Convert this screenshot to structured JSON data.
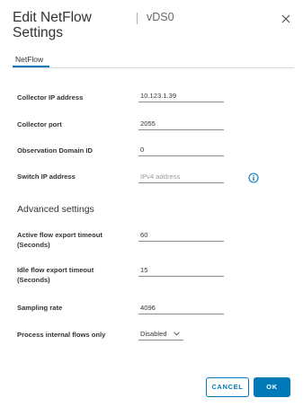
{
  "dialog": {
    "title": "Edit NetFlow Settings",
    "subtitle": "vDS0"
  },
  "tabs": [
    {
      "label": "NetFlow",
      "active": true
    }
  ],
  "fields": {
    "collector_ip": {
      "label": "Collector IP address",
      "value": "10.123.1.39",
      "placeholder": ""
    },
    "collector_port": {
      "label": "Collector port",
      "value": "2055",
      "placeholder": ""
    },
    "observation_domain_id": {
      "label": "Observation Domain ID",
      "value": "0",
      "placeholder": ""
    },
    "switch_ip": {
      "label": "Switch IP address",
      "value": "",
      "placeholder": "IPv4 address"
    }
  },
  "advanced": {
    "title": "Advanced settings",
    "active_timeout": {
      "label_line1": "Active flow export timeout",
      "label_line2": "(Seconds)",
      "value": "60"
    },
    "idle_timeout": {
      "label_line1": "Idle flow export timeout",
      "label_line2": "(Seconds)",
      "value": "15"
    },
    "sampling_rate": {
      "label": "Sampling rate",
      "value": "4096"
    },
    "internal_flows": {
      "label": "Process internal flows only",
      "value": "Disabled"
    }
  },
  "buttons": {
    "cancel": "CANCEL",
    "ok": "OK"
  },
  "colors": {
    "accent": "#0079b8",
    "text": "#333333",
    "info_icon": "#0079b8"
  },
  "icons": {
    "close": "close-icon",
    "info": "info-icon",
    "dropdown": "chevron-down-icon"
  }
}
